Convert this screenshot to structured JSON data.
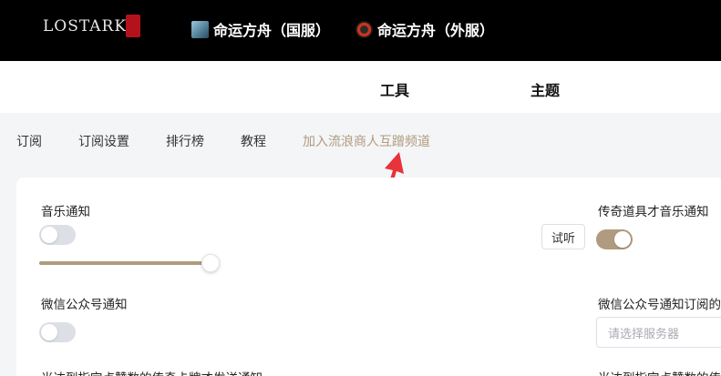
{
  "header": {
    "logo_text": "LOSTARK",
    "games": [
      {
        "label": "命运方舟（国服）",
        "icon": "game-cn-icon"
      },
      {
        "label": "命运方舟（外服）",
        "icon": "game-global-icon"
      }
    ]
  },
  "nav": {
    "items": [
      "工具",
      "主题"
    ]
  },
  "subnav": {
    "items": [
      "订阅",
      "订阅设置",
      "排行榜",
      "教程",
      "加入流浪商人互蹭频道"
    ]
  },
  "settings": {
    "music_notify_label": "音乐通知",
    "listen_button": "试听",
    "legendary_music_label": "传奇道具才音乐通知",
    "wechat_notify_label": "微信公众号通知",
    "wechat_sub_label": "微信公众号通知订阅的",
    "server_placeholder": "请选择服务器",
    "cut_left": "当达到指定点赞数的传奇卡牌才发送通知",
    "cut_right": "当达到指定点赞数的传"
  },
  "state": {
    "music_notify_on": false,
    "legendary_music_on": true,
    "wechat_notify_on": false,
    "volume": 1.0
  },
  "colors": {
    "accent": "#b09b7e",
    "arrow": "#e8333a",
    "header_bg": "#000000"
  }
}
